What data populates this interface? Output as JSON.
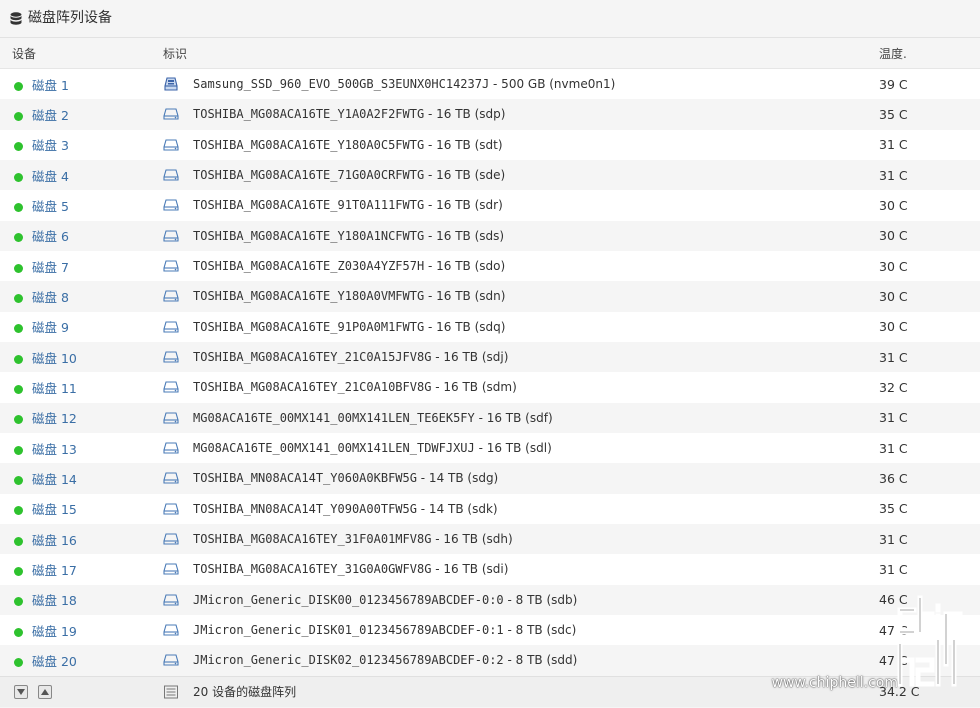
{
  "header": {
    "title": "磁盘阵列设备",
    "icon": "database-icon"
  },
  "columns": {
    "device": "设备",
    "identifier": "标识",
    "temperature": "温度."
  },
  "colors": {
    "status_ok": "#2ec22e",
    "link": "#3a6ea5"
  },
  "disks": [
    {
      "device": "磁盘 1",
      "id": "Samsung_SSD_960_EVO_500GB_S3EUNX0HC14237J",
      "tail": " - 500 GB (nvme0n1)",
      "temp": "39 C",
      "icon": "ssd-icon"
    },
    {
      "device": "磁盘 2",
      "id": "TOSHIBA_MG08ACA16TE_Y1A0A2F2FWTG",
      "tail": " - 16 TB (sdp)",
      "temp": "35 C",
      "icon": "hdd-icon"
    },
    {
      "device": "磁盘 3",
      "id": "TOSHIBA_MG08ACA16TE_Y180A0C5FWTG",
      "tail": " - 16 TB (sdt)",
      "temp": "31 C",
      "icon": "hdd-icon"
    },
    {
      "device": "磁盘 4",
      "id": "TOSHIBA_MG08ACA16TE_71G0A0CRFWTG",
      "tail": " - 16 TB (sde)",
      "temp": "31 C",
      "icon": "hdd-icon"
    },
    {
      "device": "磁盘 5",
      "id": "TOSHIBA_MG08ACA16TE_91T0A111FWTG",
      "tail": " - 16 TB (sdr)",
      "temp": "30 C",
      "icon": "hdd-icon"
    },
    {
      "device": "磁盘 6",
      "id": "TOSHIBA_MG08ACA16TE_Y180A1NCFWTG",
      "tail": " - 16 TB (sds)",
      "temp": "30 C",
      "icon": "hdd-icon"
    },
    {
      "device": "磁盘 7",
      "id": "TOSHIBA_MG08ACA16TE_Z030A4YZF57H",
      "tail": " - 16 TB (sdo)",
      "temp": "30 C",
      "icon": "hdd-icon"
    },
    {
      "device": "磁盘 8",
      "id": "TOSHIBA_MG08ACA16TE_Y180A0VMFWTG",
      "tail": " - 16 TB (sdn)",
      "temp": "30 C",
      "icon": "hdd-icon"
    },
    {
      "device": "磁盘 9",
      "id": "TOSHIBA_MG08ACA16TE_91P0A0M1FWTG",
      "tail": " - 16 TB (sdq)",
      "temp": "30 C",
      "icon": "hdd-icon"
    },
    {
      "device": "磁盘 10",
      "id": "TOSHIBA_MG08ACA16TEY_21C0A15JFV8G",
      "tail": " - 16 TB (sdj)",
      "temp": "31 C",
      "icon": "hdd-icon"
    },
    {
      "device": "磁盘 11",
      "id": "TOSHIBA_MG08ACA16TEY_21C0A10BFV8G",
      "tail": " - 16 TB (sdm)",
      "temp": "32 C",
      "icon": "hdd-icon"
    },
    {
      "device": "磁盘 12",
      "id": "MG08ACA16TE_00MX141_00MX141LEN_TE6EK5FY",
      "tail": " - 16 TB (sdf)",
      "temp": "31 C",
      "icon": "hdd-icon"
    },
    {
      "device": "磁盘 13",
      "id": "MG08ACA16TE_00MX141_00MX141LEN_TDWFJXUJ",
      "tail": " - 16 TB (sdl)",
      "temp": "31 C",
      "icon": "hdd-icon"
    },
    {
      "device": "磁盘 14",
      "id": "TOSHIBA_MN08ACA14T_Y060A0KBFW5G",
      "tail": " - 14 TB (sdg)",
      "temp": "36 C",
      "icon": "hdd-icon"
    },
    {
      "device": "磁盘 15",
      "id": "TOSHIBA_MN08ACA14T_Y090A00TFW5G",
      "tail": " - 14 TB (sdk)",
      "temp": "35 C",
      "icon": "hdd-icon"
    },
    {
      "device": "磁盘 16",
      "id": "TOSHIBA_MG08ACA16TEY_31F0A01MFV8G",
      "tail": " - 16 TB (sdh)",
      "temp": "31 C",
      "icon": "hdd-icon"
    },
    {
      "device": "磁盘 17",
      "id": "TOSHIBA_MG08ACA16TEY_31G0A0GWFV8G",
      "tail": " - 16 TB (sdi)",
      "temp": "31 C",
      "icon": "hdd-icon"
    },
    {
      "device": "磁盘 18",
      "id": "JMicron_Generic_DISK00_0123456789ABCDEF-0:0",
      "tail": " - 8 TB (sdb)",
      "temp": "46 C",
      "icon": "hdd-icon"
    },
    {
      "device": "磁盘 19",
      "id": "JMicron_Generic_DISK01_0123456789ABCDEF-0:1",
      "tail": " - 8 TB (sdc)",
      "temp": "47 C",
      "icon": "hdd-icon"
    },
    {
      "device": "磁盘 20",
      "id": "JMicron_Generic_DISK02_0123456789ABCDEF-0:2",
      "tail": " - 8 TB (sdd)",
      "temp": "47 C",
      "icon": "hdd-icon"
    }
  ],
  "footer": {
    "summary": "20 设备的磁盘阵列",
    "avg_temp": "34.2 C",
    "icon": "list-icon"
  },
  "watermark": {
    "url": "www.chiphell.com",
    "logo": "chiphell-logo"
  }
}
